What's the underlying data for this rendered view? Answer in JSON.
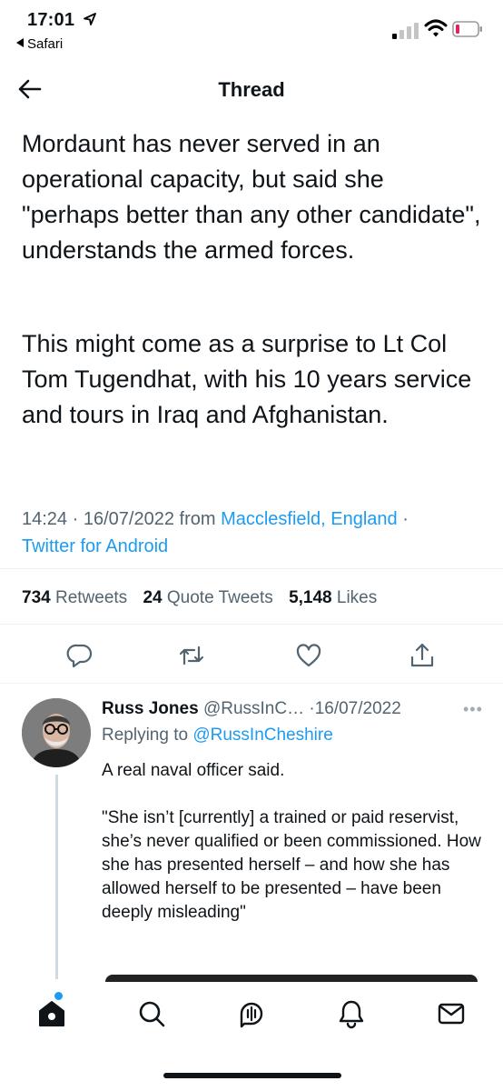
{
  "status_bar": {
    "time": "17:01",
    "back_app": "Safari"
  },
  "header": {
    "title": "Thread"
  },
  "tweet": {
    "paragraph_1": "Mordaunt has never served in an operational capacity, but said she \"perhaps better than any other candidate\", understands the armed forces.",
    "paragraph_2": "This might come as a surprise to Lt Col Tom Tugendhat, with his 10 years service and tours in Iraq and Afghanistan.",
    "time": "14:24",
    "date": "16/07/2022",
    "from_label": "from",
    "location": "Macclesfield, England",
    "client": "Twitter for Android",
    "stats": {
      "retweets_count": "734",
      "retweets_label": "Retweets",
      "quotes_count": "24",
      "quotes_label": "Quote Tweets",
      "likes_count": "5,148",
      "likes_label": "Likes"
    }
  },
  "reply": {
    "name": "Russ Jones",
    "handle": "@RussInC…",
    "date": "16/07/2022",
    "replying_to_label": "Replying to",
    "replying_to_handle": "@RussInCheshire",
    "more_glyph": "•••",
    "body": "A real naval officer said.\n\n\"She isn’t [currently] a trained or paid reservist, she’s never qualified or been commissioned. How she has presented herself – and how she has allowed herself to be presented – have been deeply misleading\""
  },
  "icons": {
    "back": "arrow-left-icon",
    "reply": "reply-icon",
    "retweet": "retweet-icon",
    "like": "heart-icon",
    "share": "share-icon",
    "tabs": [
      "home-icon",
      "search-icon",
      "spaces-icon",
      "notifications-icon",
      "messages-icon"
    ]
  },
  "colors": {
    "link": "#1d9bf0",
    "text": "#0f1419",
    "secondary": "#536471",
    "battery_low": "#e0245e"
  }
}
